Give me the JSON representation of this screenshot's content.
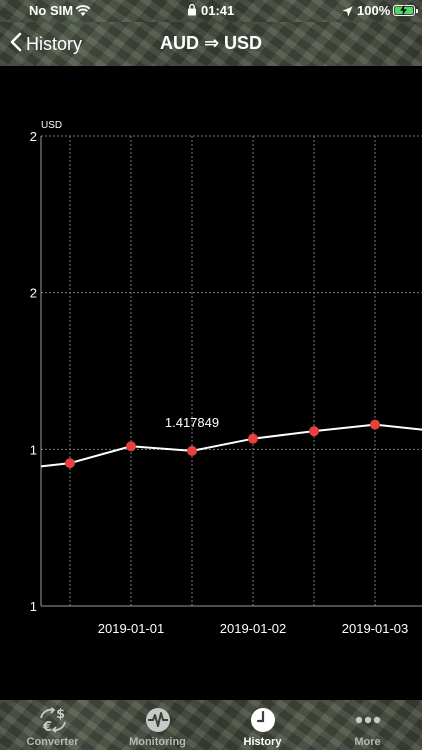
{
  "status_bar": {
    "carrier": "No SIM",
    "time": "01:41",
    "battery": "100%"
  },
  "nav": {
    "back_label": "History",
    "title": "AUD ⇒ USD"
  },
  "colors": {
    "line": "#ffffff",
    "point": "#e8413c",
    "grid": "#7a7a7a",
    "tab_active": "#ffffff",
    "tab_inactive": "#b7b7b7"
  },
  "chart_data": {
    "type": "line",
    "ylabel": "USD",
    "y_tick_labels": [
      "2",
      "2",
      "1",
      "1"
    ],
    "x_tick_labels": [
      "2019-01-01",
      "2019-01-02",
      "2019-01-03"
    ],
    "annotation": "1.417849",
    "grid": true,
    "series": [
      {
        "x": [
          "2018-12-31 12:00",
          "2019-01-01 00:00",
          "2019-01-01 12:00",
          "2019-01-02 00:00",
          "2019-01-02 12:00",
          "2019-01-03 00:00"
        ],
        "values": [
          1.402,
          1.42,
          1.415,
          1.428,
          1.436,
          1.443
        ]
      }
    ]
  },
  "tabs": [
    {
      "label": "Converter",
      "icon": "currency-exchange-icon"
    },
    {
      "label": "Monitoring",
      "icon": "activity-icon"
    },
    {
      "label": "History",
      "icon": "clock-icon"
    },
    {
      "label": "More",
      "icon": "more-dots-icon"
    }
  ]
}
